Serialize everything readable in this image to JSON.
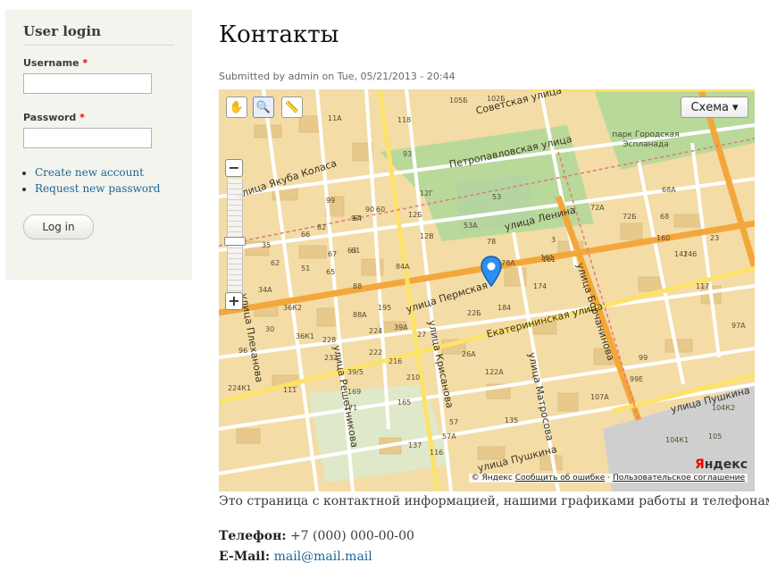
{
  "sidebar": {
    "title": "User login",
    "username_label": "Username",
    "password_label": "Password",
    "required_mark": "*",
    "username_value": "",
    "password_value": "",
    "links": [
      {
        "label": "Create new account"
      },
      {
        "label": "Request new password"
      }
    ],
    "login_button": "Log in"
  },
  "content": {
    "title": "Контакты",
    "submitted": "Submitted by admin on Tue, 05/21/2013 - 20:44",
    "body": "Это страница с контактной информацией, нашими графиками работы и телефонами.",
    "phone_label": "Телефон:",
    "phone_value": "+7 (000) 000-00-00",
    "email_label": "E-Mail:",
    "email_value": "mail@mail.mail"
  },
  "map": {
    "layer_button": "Схема",
    "layer_arrow": "▾",
    "copyright": "© Яндекс",
    "report_error": "Сообщить об ошибке",
    "terms": "Пользовательское соглашение",
    "separator": "·",
    "logo_first": "Я",
    "logo_rest": "ндекс",
    "zoom_in": "+",
    "zoom_out": "−",
    "tools": [
      "hand-icon",
      "magnifier-icon",
      "ruler-icon"
    ],
    "streets": [
      "Советская улица",
      "Петропавловская улица",
      "парк Городская Эспланада",
      "улица Ленина",
      "улица Якуба Коласа",
      "улица Плеханова",
      "улица Пермская",
      "Екатерининская улица",
      "улица Борчанинова",
      "улица Пушкина",
      "улица Решетникова",
      "улица Крисанова",
      "улица Матросова",
      "улица Пушкина"
    ],
    "house_numbers": [
      "11A",
      "118",
      "105Б",
      "102Б",
      "93",
      "90",
      "12Г",
      "12Б",
      "12В",
      "53А",
      "53",
      "78",
      "78А",
      "161",
      "3",
      "72А",
      "72Б",
      "68А",
      "68",
      "160",
      "146",
      "142",
      "23",
      "84А",
      "65",
      "67",
      "88",
      "88А",
      "195",
      "36К2",
      "36К1",
      "228",
      "232",
      "224",
      "39А",
      "27",
      "22Б",
      "184",
      "174",
      "117",
      "222",
      "216",
      "26А",
      "122А",
      "107А",
      "99",
      "99Е",
      "97А",
      "224К1",
      "169",
      "171",
      "137",
      "57А",
      "57",
      "116",
      "135",
      "104К1",
      "104К2",
      "105",
      "161",
      "63",
      "61",
      "51",
      "99",
      "97",
      "60",
      "82",
      "66",
      "64",
      "62",
      "34А",
      "35",
      "30",
      "96",
      "39/5",
      "210",
      "165",
      "111",
      "12",
      "46",
      "104К1",
      "78"
    ],
    "pin_color": "#1e90ff"
  }
}
